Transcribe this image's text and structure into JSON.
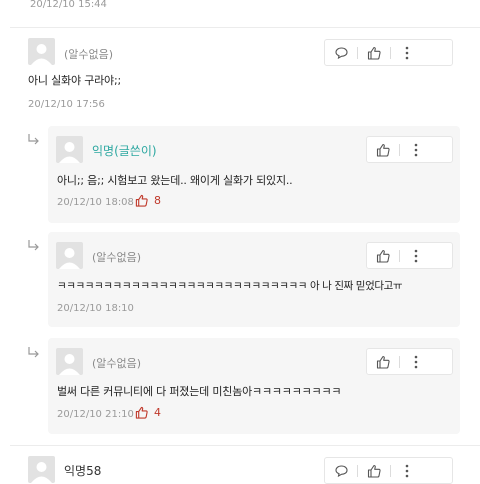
{
  "top_timestamp": "20/12/10 15:44",
  "comments": [
    {
      "author": "(알수없음)",
      "text": "아니 실화야 구라야;;",
      "timestamp": "20/12/10 17:56"
    },
    {
      "author": "익명58"
    }
  ],
  "replies": [
    {
      "author": "익명(글쓴이)",
      "text": "아니;; 음;; 시험보고 왔는데.. 왜이게 실화가 되있지..",
      "timestamp": "20/12/10 18:08",
      "likes": "8"
    },
    {
      "author": "(알수없음)",
      "text": "ㅋㅋㅋㅋㅋㅋㅋㅋㅋㅋㅋㅋㅋㅋㅋㅋㅋㅋㅋㅋㅋㅋㅋㅋㅋㅋㅋ 아 나 진짜 믿었다고ㅠ",
      "timestamp": "20/12/10 18:10"
    },
    {
      "author": "(알수없음)",
      "text": "벌써 다른 커뮤니티에 다 퍼졌는데 미친놈아ㅋㅋㅋㅋㅋㅋㅋㅋㅋ",
      "timestamp": "20/12/10 21:10",
      "likes": "4"
    }
  ],
  "colors": {
    "author_op": "#2ba7a0",
    "likes": "#c0392b",
    "reply_bg": "#f6f6f6"
  },
  "icons": {
    "reply": "speech-bubble-icon",
    "like": "thumbs-up-icon",
    "more": "kebab-menu-icon",
    "arrow": "reply-arrow-icon"
  }
}
